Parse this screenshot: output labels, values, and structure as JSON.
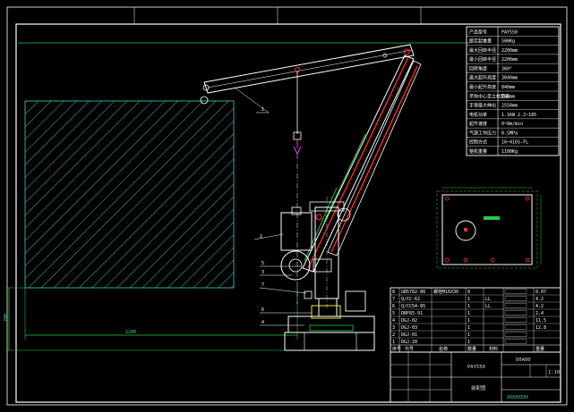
{
  "colors": {
    "background": "#000000",
    "frame": "#ffffff",
    "structure": "#ffffff",
    "red": "#ff3030",
    "green": "#27c93f",
    "cyan": "#3fd0c0",
    "magenta": "#ff40ff",
    "yellow": "#ffff40",
    "blue": "#3060ff"
  },
  "spec_table": {
    "rows": [
      {
        "label": "产品型号",
        "value": "PAY550"
      },
      {
        "label": "额定起重量",
        "value": "500Kg"
      },
      {
        "label": "最大回转半径",
        "value": "2200mm"
      },
      {
        "label": "最小回转半径",
        "value": "2200mm"
      },
      {
        "label": "回转角度",
        "value": "360°"
      },
      {
        "label": "最大起升高度",
        "value": "3040mm"
      },
      {
        "label": "最小起升高度",
        "value": "840mm"
      },
      {
        "label": "吊钩中心至立柱距离",
        "value": "700mm"
      },
      {
        "label": "手臂最大伸出",
        "value": "2550mm"
      },
      {
        "label": "电机功率",
        "value": "1.1KW 2.2~185"
      },
      {
        "label": "起升速度",
        "value": "0~8m/min"
      },
      {
        "label": "气源工作压力",
        "value": "0.5MPa"
      },
      {
        "label": "控制方式",
        "value": "16~416S-FL"
      },
      {
        "label": "整机重量",
        "value": "1100Kg"
      }
    ]
  },
  "callouts": [
    "1",
    "2",
    "3",
    "4",
    "5",
    "6",
    "7"
  ],
  "dimensions": {
    "horizontal": "2200",
    "vertical": "700"
  },
  "bom": {
    "rows": [
      {
        "no": "8",
        "code": "GB5782-86",
        "name": "螺栓M16X30",
        "qty": "8",
        "mat": "",
        "weight": "0.07"
      },
      {
        "no": "7",
        "code": "Q/CC-62",
        "name": "",
        "qty": "1",
        "mat": "LL",
        "weight": "4.2"
      },
      {
        "no": "6",
        "code": "Q/CC54-85",
        "name": "",
        "qty": "1",
        "mat": "LL",
        "weight": "4.2"
      },
      {
        "no": "5",
        "code": "DBF65-91",
        "name": "",
        "qty": "1",
        "mat": "",
        "weight": "2.4"
      },
      {
        "no": "4",
        "code": "DGJ-02",
        "name": "",
        "qty": "1",
        "mat": "",
        "weight": "11.5"
      },
      {
        "no": "3",
        "code": "DGJ-03",
        "name": "",
        "qty": "1",
        "mat": "",
        "weight": "12.8"
      },
      {
        "no": "2",
        "code": "DGJ-01",
        "name": "",
        "qty": "1",
        "mat": "",
        "weight": ""
      },
      {
        "no": "1",
        "code": "DGJ-20",
        "name": "",
        "qty": "1",
        "mat": "",
        "weight": ""
      }
    ],
    "header": [
      "序号",
      "代号",
      "名称",
      "数量",
      "材料",
      "重量"
    ]
  },
  "title_block": {
    "model": "PAY550",
    "drawing_no": "D0A00",
    "scale": "1:10",
    "label": "装配图",
    "company": "XXXXXXXX"
  }
}
